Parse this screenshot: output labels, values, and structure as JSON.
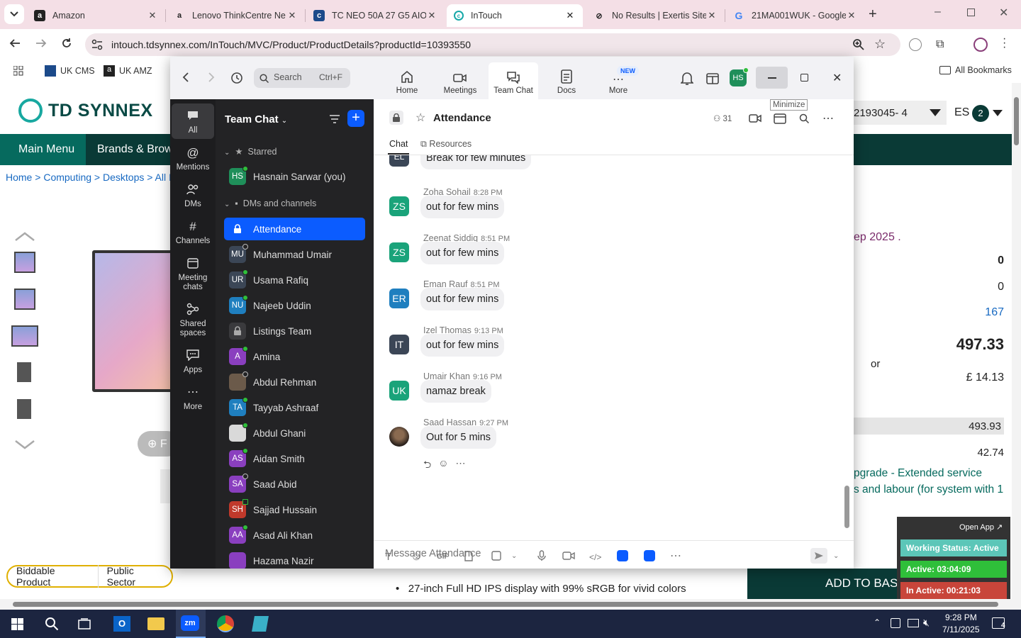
{
  "browser": {
    "tabs": [
      {
        "title": "Amazon",
        "favicon": "a"
      },
      {
        "title": "Lenovo ThinkCentre Ne",
        "favicon": "a"
      },
      {
        "title": "TC NEO 50A 27 G5 AIO",
        "favicon": "c"
      },
      {
        "title": "InTouch",
        "favicon": "c"
      },
      {
        "title": "No Results | Exertis Site",
        "favicon": "x"
      },
      {
        "title": "21MA001WUK - Google",
        "favicon": "G"
      }
    ],
    "url": "intouch.tdsynnex.com/InTouch/MVC/Product/ProductDetails?productId=10393550",
    "bookmarks": [
      "UK CMS",
      "UK AMZ"
    ],
    "all_bookmarks": "All Bookmarks",
    "colors": {
      "tabstrip": "#f4dfe6"
    }
  },
  "site": {
    "logo": "TD SYNNEX",
    "account_code": "2193045- 4",
    "lang": "ES",
    "badge": "2",
    "menu": [
      "Main Menu",
      "Brands & Brow"
    ],
    "breadcrumb": [
      "Home",
      "Computing",
      "Desktops",
      "All I"
    ],
    "date_text": "ep 2025 .",
    "values": [
      "0",
      "0",
      "167"
    ],
    "price": "497.33",
    "or": "or",
    "monthly": "£ 14.13",
    "row1": "493.93",
    "row2": "42.74",
    "upgrade_line1": "pgrade - Extended service",
    "upgrade_line2": "s and labour (for system with 1",
    "tags": [
      "Biddable Product",
      "Public Sector"
    ],
    "bullet": "27-inch Full HD IPS display with 99% sRGB for vivid colors",
    "add_to_basket": "ADD TO BASKET",
    "widget": {
      "open_app": "Open App",
      "status": "Working Status: Active",
      "active": "Active: 03:04:09",
      "inactive": "In Active: 00:21:03"
    },
    "carousel_btn": "F"
  },
  "zoom": {
    "search_placeholder": "Search",
    "search_shortcut": "Ctrl+F",
    "nav": [
      {
        "label": "Home",
        "icon": "home-icon"
      },
      {
        "label": "Meetings",
        "icon": "camera-icon"
      },
      {
        "label": "Team Chat",
        "icon": "chat-icon"
      },
      {
        "label": "Docs",
        "icon": "doc-icon"
      },
      {
        "label": "More",
        "icon": "more-icon"
      }
    ],
    "new_badge": "NEW",
    "avatar": "HS",
    "minimize_tooltip": "Minimize",
    "rail": [
      {
        "label": "All"
      },
      {
        "label": "Mentions"
      },
      {
        "label": "DMs"
      },
      {
        "label": "Channels"
      },
      {
        "label": "Meeting chats"
      },
      {
        "label": "Shared spaces"
      },
      {
        "label": "Apps"
      },
      {
        "label": "More"
      }
    ],
    "list_title": "Team Chat",
    "starred_header": "Starred",
    "dms_header": "DMs and channels",
    "starred": [
      {
        "name": "Hasnain Sarwar (you)",
        "initials": "HS",
        "color": "#1f8f5a"
      }
    ],
    "items": [
      {
        "name": "Attendance",
        "initials": "",
        "color": "#0b5cff",
        "type": "lock",
        "active": true
      },
      {
        "name": "Muhammad Umair",
        "initials": "MU",
        "color": "#3b4656",
        "status": "away"
      },
      {
        "name": "Usama Rafiq",
        "initials": "UR",
        "color": "#3b4656",
        "status": "online"
      },
      {
        "name": "Najeeb Uddin",
        "initials": "NU",
        "color": "#1f7fbf",
        "status": "online"
      },
      {
        "name": "Listings Team",
        "initials": "",
        "color": "#3a3a3d",
        "type": "lock"
      },
      {
        "name": "Amina",
        "initials": "A",
        "color": "#8a3fbf",
        "status": "online"
      },
      {
        "name": "Abdul Rehman",
        "initials": "",
        "color": "#6b5a4a",
        "status": "away",
        "type": "photo"
      },
      {
        "name": "Tayyab Ashraaf",
        "initials": "TA",
        "color": "#1f7fbf",
        "status": "online"
      },
      {
        "name": "Abdul Ghani",
        "initials": "",
        "color": "#d9d9d9",
        "status": "online",
        "type": "photo"
      },
      {
        "name": "Aidan Smith",
        "initials": "AS",
        "color": "#8a3fbf",
        "status": "online"
      },
      {
        "name": "Saad Abid",
        "initials": "SA",
        "color": "#8a3fbf",
        "status": "away"
      },
      {
        "name": "Sajjad Hussain",
        "initials": "SH",
        "color": "#c0392b",
        "status": "phone"
      },
      {
        "name": "Asad Ali Khan",
        "initials": "AA",
        "color": "#8a3fbf",
        "status": "online"
      },
      {
        "name": "Hazama Nazir",
        "initials": "",
        "color": "#8a3fbf",
        "status": ""
      }
    ],
    "channel": {
      "name": "Attendance",
      "members": "31",
      "tabs": [
        "Chat",
        "Resources"
      ],
      "compose_placeholder": "Message Attendance"
    },
    "messages": [
      {
        "author": "",
        "time": "",
        "initials": "EL",
        "color": "#3b4656",
        "text": "Break for few minutes"
      },
      {
        "author": "Zoha Sohail",
        "time": "8:28 PM",
        "initials": "ZS",
        "color": "#1aa37a",
        "text": "out for few mins"
      },
      {
        "author": "Zeenat Siddiq",
        "time": "8:51 PM",
        "initials": "ZS",
        "color": "#1aa37a",
        "text": "out for few mins"
      },
      {
        "author": "Eman Rauf",
        "time": "8:51 PM",
        "initials": "ER",
        "color": "#1f7fbf",
        "text": "out for few mins"
      },
      {
        "author": "Izel Thomas",
        "time": "9:13 PM",
        "initials": "IT",
        "color": "#3b4656",
        "text": "out for few mins"
      },
      {
        "author": "Umair Khan",
        "time": "9:16 PM",
        "initials": "UK",
        "color": "#1aa37a",
        "text": "namaz break"
      },
      {
        "author": "Saad Hassan",
        "time": "9:27 PM",
        "initials": "",
        "color": "#3a2e26",
        "text": "Out for 5 mins"
      }
    ]
  },
  "taskbar": {
    "time": "9:28 PM",
    "date": "7/11/2025",
    "notif": "4",
    "zoom_label": "zm"
  }
}
